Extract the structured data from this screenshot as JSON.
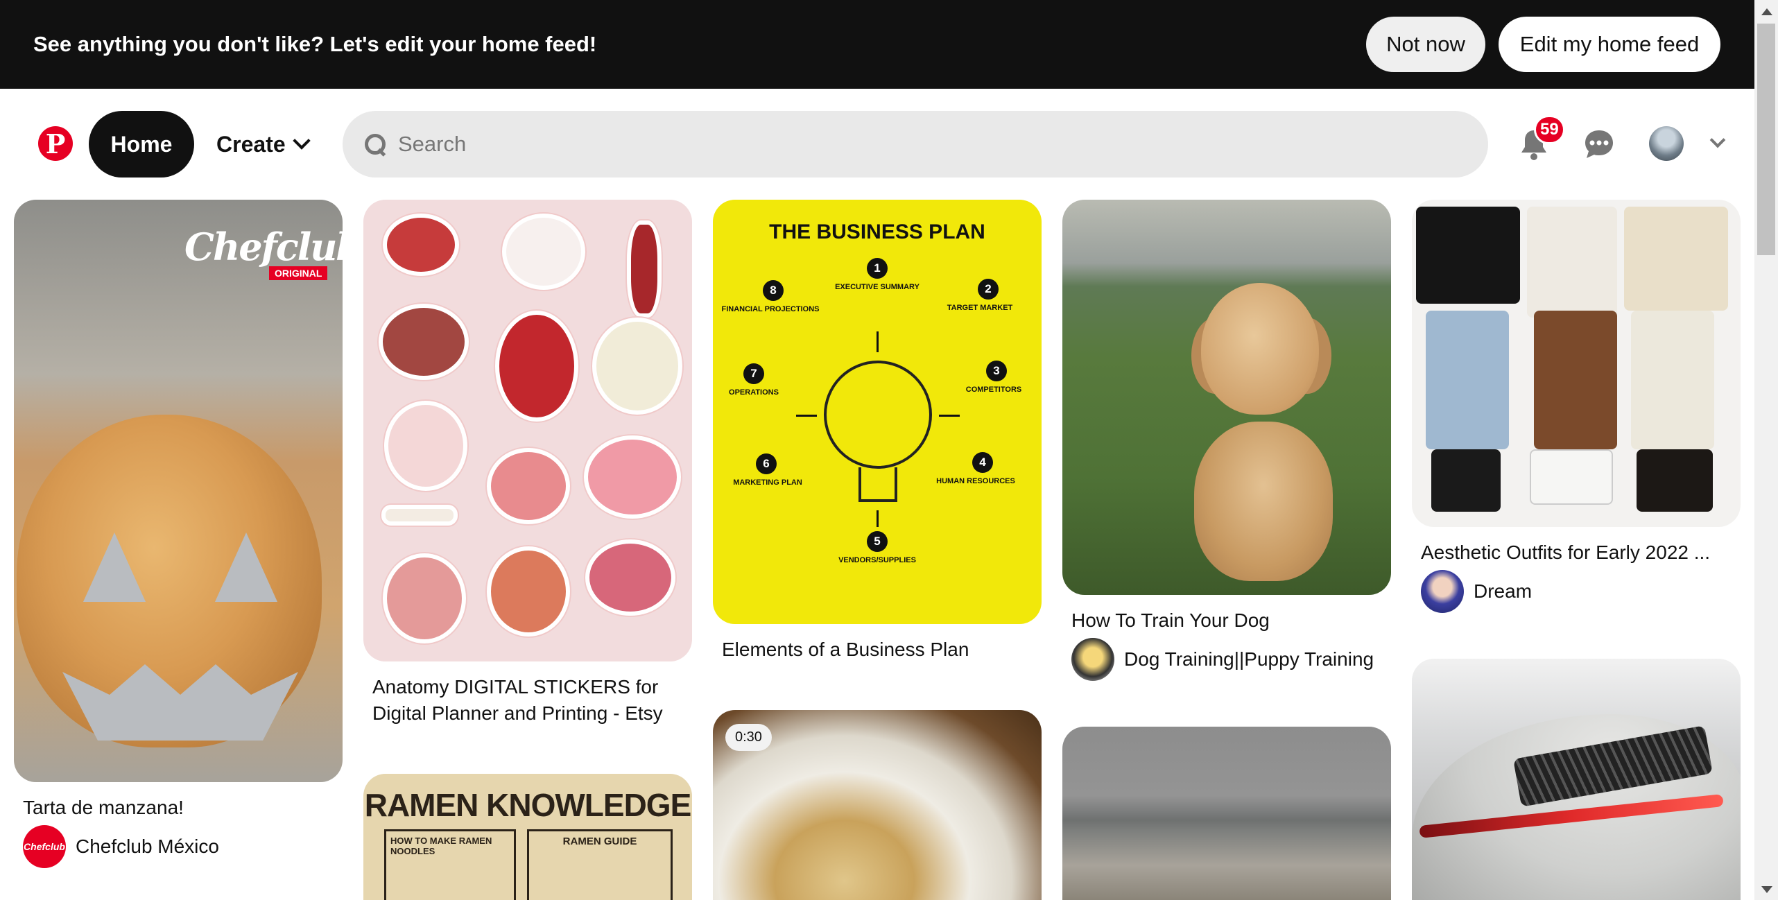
{
  "banner": {
    "text": "See anything you don't like? Let's edit your home feed!",
    "not_now": "Not now",
    "edit_feed": "Edit my home feed"
  },
  "header": {
    "logo": "P",
    "home": "Home",
    "create": "Create",
    "search_placeholder": "Search",
    "notification_count": "59"
  },
  "pins": [
    {
      "title": "Tarta de manzana!",
      "creator": "Chefclub México",
      "overlay_brand": "Chefclub",
      "overlay_tag": "ORIGINAL",
      "creator_logo": "Chefclub"
    },
    {
      "title": "Anatomy DIGITAL STICKERS for Digital Planner and Printing - Etsy"
    },
    {
      "title": "Elements of a Business Plan",
      "image_heading": "THE BUSINESS PLAN"
    },
    {
      "title": "How To Train Your Dog",
      "creator": "Dog Training||Puppy Training"
    },
    {
      "title": "Aesthetic Outfits for Early 2022 ...",
      "creator": "Dream"
    },
    {
      "image_heading": "RAMEN KNOWLEDGE"
    },
    {
      "duration": "0:30"
    },
    {},
    {}
  ],
  "business_plan": {
    "items": [
      {
        "num": "1",
        "label": "EXECUTIVE SUMMARY"
      },
      {
        "num": "2",
        "label": "TARGET MARKET"
      },
      {
        "num": "3",
        "label": "COMPETITORS"
      },
      {
        "num": "4",
        "label": "HUMAN RESOURCES"
      },
      {
        "num": "5",
        "label": "VENDORS/SUPPLIES"
      },
      {
        "num": "6",
        "label": "MARKETING PLAN"
      },
      {
        "num": "7",
        "label": "OPERATIONS"
      },
      {
        "num": "8",
        "label": "FINANCIAL PROJECTIONS"
      }
    ]
  },
  "ramen": {
    "sub1": "HOW TO MAKE RAMEN NOODLES",
    "sub2": "RAMEN GUIDE"
  },
  "colors": {
    "brand": "#e60023",
    "banner_bg": "#111111",
    "search_bg": "#e9e9e9"
  }
}
